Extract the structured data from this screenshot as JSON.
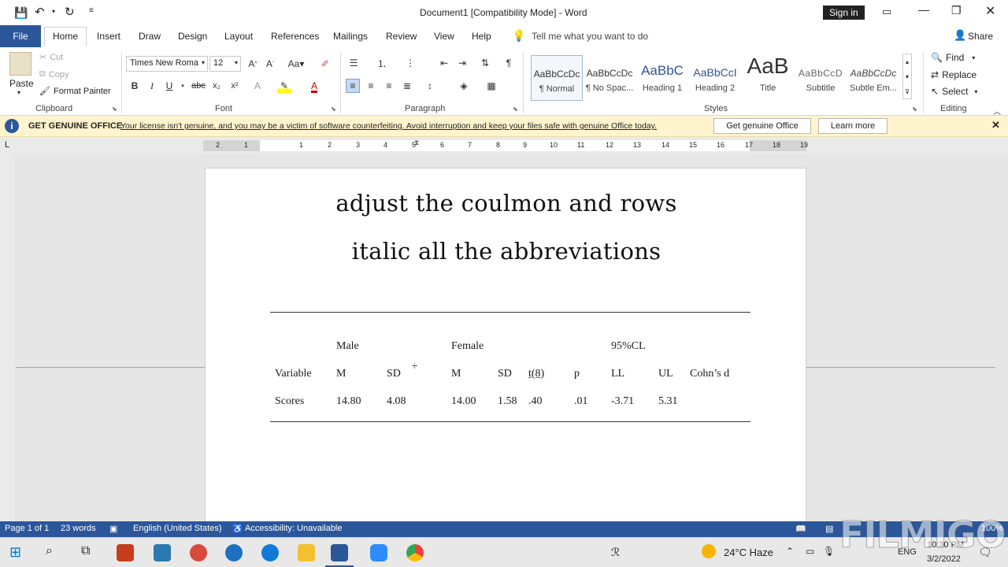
{
  "titlebar": {
    "title": "Document1 [Compatibility Mode]  -  Word",
    "sign_in": "Sign in"
  },
  "tabs": [
    "File",
    "Home",
    "Insert",
    "Draw",
    "Design",
    "Layout",
    "References",
    "Mailings",
    "Review",
    "View",
    "Help"
  ],
  "tell_me": "Tell me what you want to do",
  "share": "Share",
  "clipboard": {
    "paste": "Paste",
    "cut": "Cut",
    "copy": "Copy",
    "format_painter": "Format Painter",
    "label": "Clipboard"
  },
  "font": {
    "name": "Times New Roma",
    "size": "12",
    "label": "Font"
  },
  "paragraph": {
    "label": "Paragraph"
  },
  "styles": {
    "label": "Styles",
    "items": [
      {
        "preview": "AaBbCcDc",
        "name": "¶ Normal"
      },
      {
        "preview": "AaBbCcDc",
        "name": "¶ No Spac..."
      },
      {
        "preview": "AaBbC",
        "name": "Heading 1"
      },
      {
        "preview": "AaBbCcI",
        "name": "Heading 2"
      },
      {
        "preview": "AaB",
        "name": "Title"
      },
      {
        "preview": "AaBbCcD",
        "name": "Subtitle"
      },
      {
        "preview": "AaBbCcDc",
        "name": "Subtle Em..."
      }
    ]
  },
  "editing": {
    "find": "Find",
    "replace": "Replace",
    "select": "Select",
    "label": "Editing"
  },
  "infobar": {
    "title": "GET GENUINE OFFICE",
    "message": "Your license isn't genuine, and you may be a victim of software counterfeiting. Avoid interruption and keep your files safe with genuine Office today.",
    "btn_get": "Get genuine Office",
    "btn_learn": "Learn more"
  },
  "ruler": [
    "2",
    "1",
    "1",
    "2",
    "3",
    "4",
    "5",
    "6",
    "7",
    "8",
    "9",
    "10",
    "11",
    "12",
    "13",
    "14",
    "15",
    "16",
    "17",
    "18",
    "19"
  ],
  "overlay": {
    "line1": "adjust the coulmon and rows",
    "line2": "italic all the abbreviations"
  },
  "table": {
    "group_headers": [
      "Male",
      "Female",
      "95%CL"
    ],
    "headers": [
      "Variable",
      "M",
      "SD",
      "M",
      "SD",
      "t(8)",
      "p",
      "LL",
      "UL",
      "Cohn’s d"
    ],
    "row": [
      "Scores",
      "14.80",
      "4.08",
      "14.00",
      "1.58",
      ".40",
      ".01",
      "-3.71",
      "5.31"
    ]
  },
  "statusbar": {
    "page": "Page 1 of 1",
    "words": "23 words",
    "language": "English (United States)",
    "accessibility": "Accessibility: Unavailable",
    "zoom": "100%"
  },
  "taskbar": {
    "weather": "24°C  Haze",
    "lang": "ENG",
    "time": "10:30 PM",
    "date": "3/2/2022"
  },
  "watermark": "FILMIGO"
}
